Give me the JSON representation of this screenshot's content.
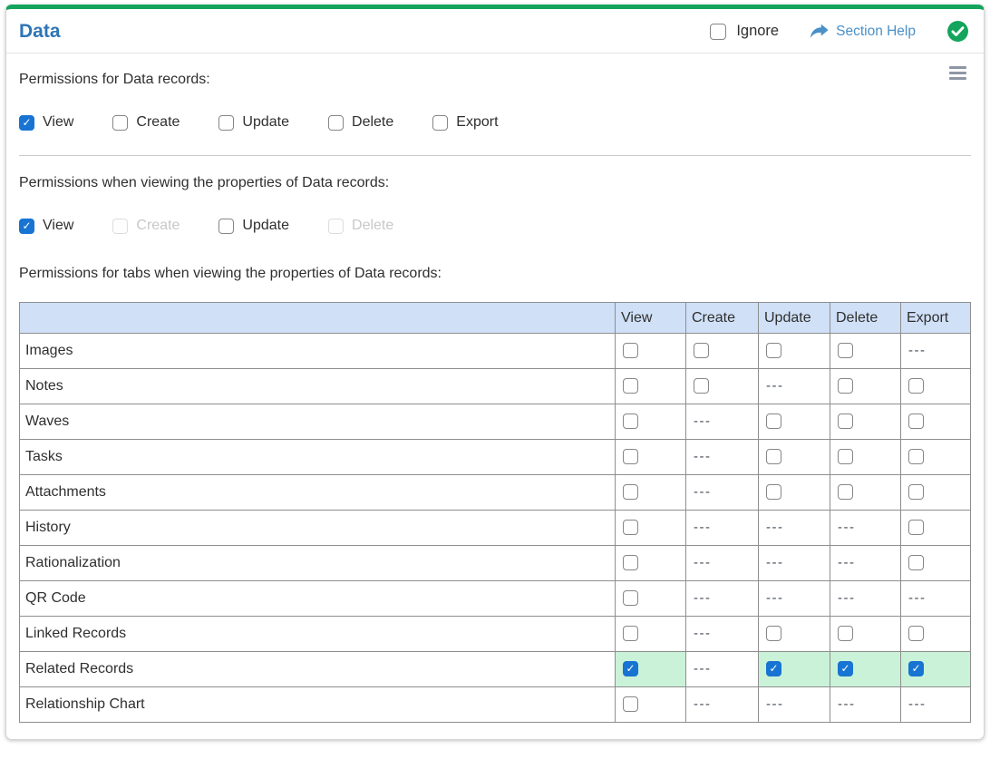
{
  "header": {
    "title": "Data",
    "ignore_label": "Ignore",
    "section_help_label": "Section Help",
    "status_icon": "check-circle-icon"
  },
  "body": {
    "sections": [
      {
        "heading": "Permissions for Data records:",
        "checkboxes": [
          {
            "label": "View",
            "checked": true,
            "disabled": false
          },
          {
            "label": "Create",
            "checked": false,
            "disabled": false
          },
          {
            "label": "Update",
            "checked": false,
            "disabled": false
          },
          {
            "label": "Delete",
            "checked": false,
            "disabled": false
          },
          {
            "label": "Export",
            "checked": false,
            "disabled": false
          }
        ]
      },
      {
        "heading": "Permissions when viewing the properties of Data records:",
        "checkboxes": [
          {
            "label": "View",
            "checked": true,
            "disabled": false
          },
          {
            "label": "Create",
            "checked": false,
            "disabled": true
          },
          {
            "label": "Update",
            "checked": false,
            "disabled": false
          },
          {
            "label": "Delete",
            "checked": false,
            "disabled": true
          }
        ]
      }
    ],
    "table": {
      "heading": "Permissions for tabs when viewing the properties of Data records:",
      "columns": [
        "View",
        "Create",
        "Update",
        "Delete",
        "Export"
      ],
      "na_text": "---",
      "rows": [
        {
          "label": "Images",
          "cells": [
            "unchecked",
            "unchecked",
            "unchecked",
            "unchecked",
            "na"
          ]
        },
        {
          "label": "Notes",
          "cells": [
            "unchecked",
            "unchecked",
            "na",
            "unchecked",
            "unchecked"
          ]
        },
        {
          "label": "Waves",
          "cells": [
            "unchecked",
            "na",
            "unchecked",
            "unchecked",
            "unchecked"
          ]
        },
        {
          "label": "Tasks",
          "cells": [
            "unchecked",
            "na",
            "unchecked",
            "unchecked",
            "unchecked"
          ]
        },
        {
          "label": "Attachments",
          "cells": [
            "unchecked",
            "na",
            "unchecked",
            "unchecked",
            "unchecked"
          ]
        },
        {
          "label": "History",
          "cells": [
            "unchecked",
            "na",
            "na",
            "na",
            "unchecked"
          ]
        },
        {
          "label": "Rationalization",
          "cells": [
            "unchecked",
            "na",
            "na",
            "na",
            "unchecked"
          ]
        },
        {
          "label": "QR Code",
          "cells": [
            "unchecked",
            "na",
            "na",
            "na",
            "na"
          ]
        },
        {
          "label": "Linked Records",
          "cells": [
            "unchecked",
            "na",
            "unchecked",
            "unchecked",
            "unchecked"
          ]
        },
        {
          "label": "Related Records",
          "cells": [
            "checked",
            "na",
            "checked",
            "checked",
            "checked"
          ]
        },
        {
          "label": "Relationship Chart",
          "cells": [
            "unchecked",
            "na",
            "na",
            "na",
            "na"
          ]
        }
      ]
    }
  },
  "colors": {
    "accent_green": "#14a45c",
    "title_blue": "#2e75b6",
    "link_blue": "#4a90c9",
    "checkbox_blue": "#1874d2",
    "table_header_bg": "#cfe0f7",
    "checked_cell_bg": "#c9f2d8"
  }
}
